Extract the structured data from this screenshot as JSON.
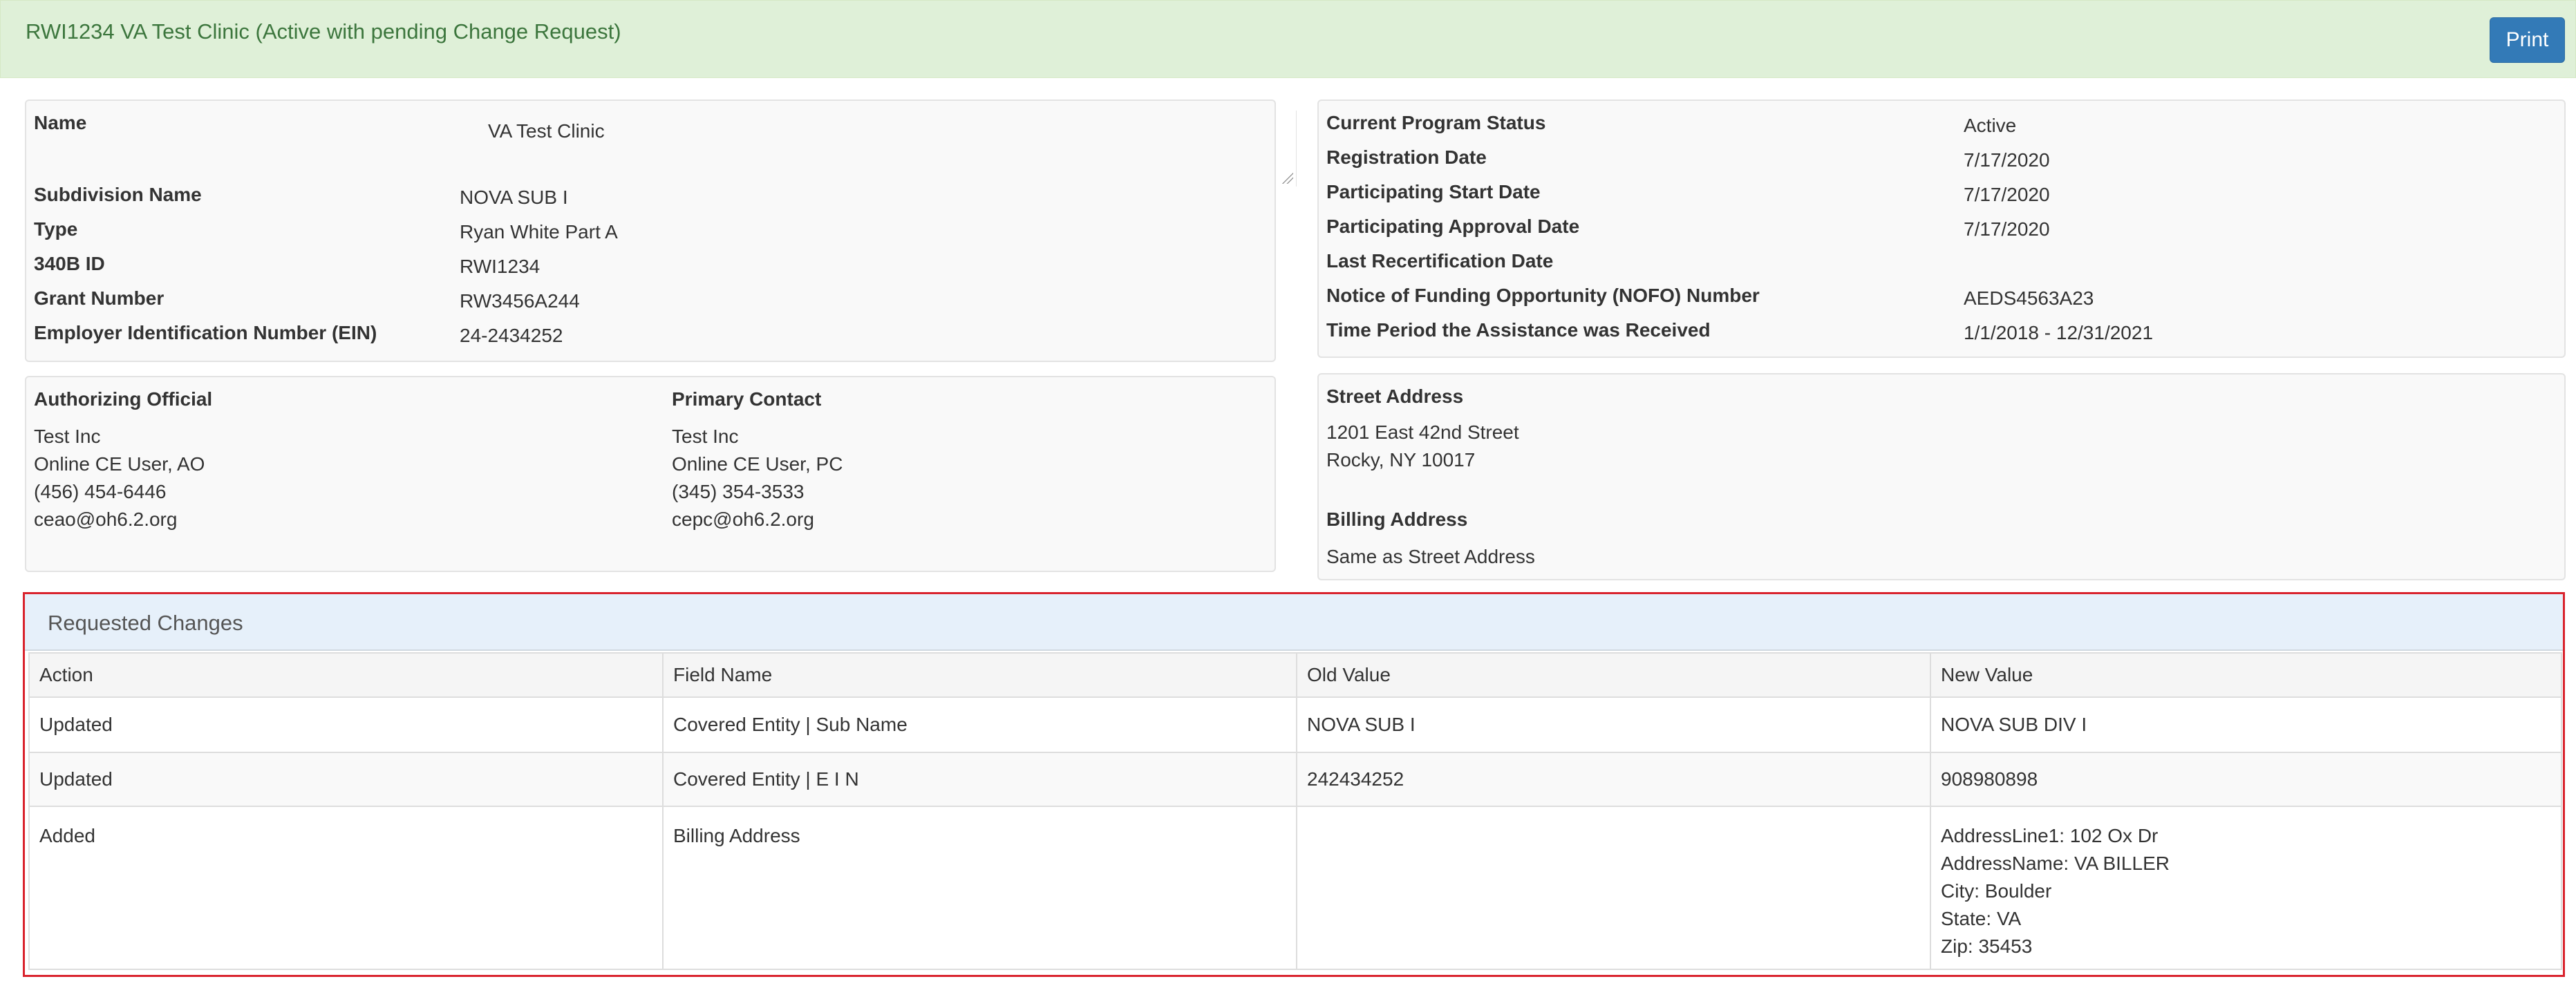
{
  "header": {
    "title": "RWI1234 VA Test Clinic (Active with pending Change Request)",
    "print_label": "Print"
  },
  "entity": {
    "name_label": "Name",
    "name_value": "VA Test Clinic",
    "subdivision_label": "Subdivision Name",
    "subdivision_value": "NOVA SUB I",
    "type_label": "Type",
    "type_value": "Ryan White Part A",
    "id_label": "340B ID",
    "id_value": "RWI1234",
    "grant_label": "Grant Number",
    "grant_value": "RW3456A244",
    "ein_label": "Employer Identification Number (EIN)",
    "ein_value": "24-2434252"
  },
  "status": {
    "program_status_label": "Current Program Status",
    "program_status_value": "Active",
    "registration_label": "Registration Date",
    "registration_value": "7/17/2020",
    "start_label": "Participating Start Date",
    "start_value": "7/17/2020",
    "approval_label": "Participating Approval Date",
    "approval_value": "7/17/2020",
    "recert_label": "Last Recertification Date",
    "recert_value": "",
    "nofo_label": "Notice of Funding Opportunity (NOFO) Number",
    "nofo_value": "AEDS4563A23",
    "period_label": "Time Period the Assistance was Received",
    "period_value": "1/1/2018 - 12/31/2021"
  },
  "contacts": {
    "ao_label": "Authorizing Official",
    "ao_lines": [
      "Test Inc",
      "Online CE User, AO",
      "(456) 454-6446",
      "ceao@oh6.2.org"
    ],
    "pc_label": "Primary Contact",
    "pc_lines": [
      "Test Inc",
      "Online CE User, PC",
      "(345) 354-3533",
      "cepc@oh6.2.org"
    ]
  },
  "address": {
    "street_label": "Street Address",
    "street_lines": [
      "1201 East 42nd Street",
      "Rocky, NY 10017"
    ],
    "billing_label": "Billing Address",
    "billing_value": "Same as Street Address"
  },
  "requested_changes": {
    "heading": "Requested Changes",
    "columns": [
      "Action",
      "Field Name",
      "Old Value",
      "New Value"
    ],
    "rows": [
      {
        "action": "Updated",
        "field": "Covered Entity | Sub Name",
        "old": "NOVA SUB I",
        "new_lines": [
          "NOVA SUB DIV I"
        ]
      },
      {
        "action": "Updated",
        "field": "Covered Entity | E I N",
        "old": "242434252",
        "new_lines": [
          "908980898"
        ]
      },
      {
        "action": "Added",
        "field": "Billing Address",
        "old": "",
        "new_lines": [
          "AddressLine1: 102 Ox Dr",
          "AddressName: VA BILLER",
          "City: Boulder",
          "State: VA",
          "Zip: 35453"
        ]
      }
    ]
  },
  "colors": {
    "header_bg": "#dff0d8",
    "header_text": "#3c763d",
    "button_primary": "#337ab7",
    "highlight_border": "#d9232d",
    "panel_heading_bg": "#e6f0fa"
  }
}
